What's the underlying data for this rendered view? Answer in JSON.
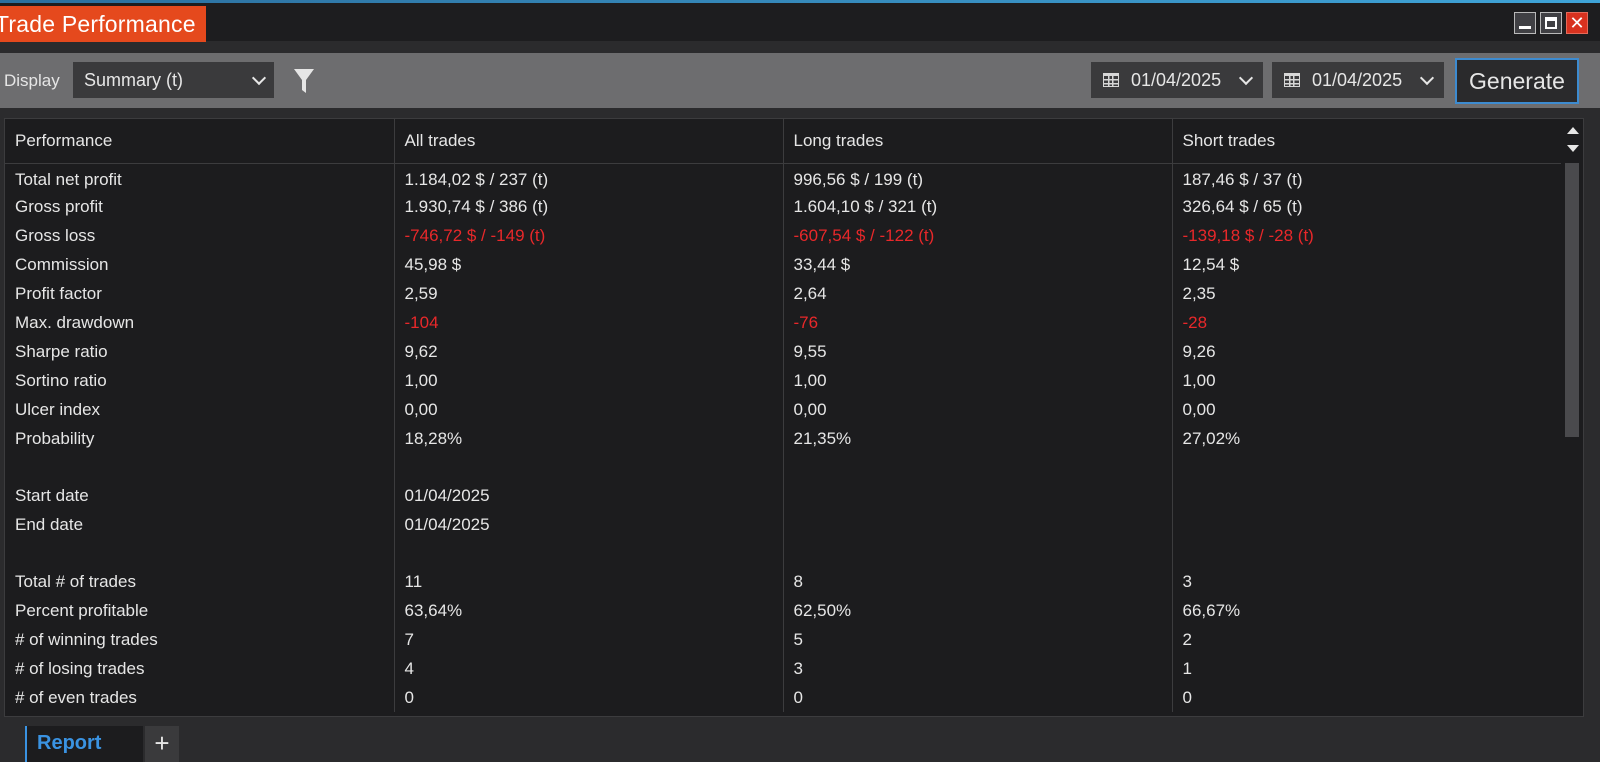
{
  "window": {
    "title": "Trade Performance"
  },
  "toolbar": {
    "display_label": "Display",
    "display_value": "Summary (t)",
    "date_from": "01/04/2025",
    "date_to": "01/04/2025",
    "generate_label": "Generate"
  },
  "table": {
    "headers": [
      "Performance",
      "All trades",
      "Long trades",
      "Short trades"
    ],
    "rows": [
      {
        "label": "Total net profit",
        "all": "1.184,02 $ / 237 (t)",
        "long": "996,56 $ / 199 (t)",
        "short": "187,46 $ / 37 (t)"
      },
      {
        "label": "Gross profit",
        "all": "1.930,74 $ / 386 (t)",
        "long": "1.604,10 $ / 321 (t)",
        "short": "326,64 $ / 65 (t)"
      },
      {
        "label": "Gross loss",
        "all": "-746,72 $ / -149 (t)",
        "long": "-607,54 $ / -122 (t)",
        "short": "-139,18 $ / -28 (t)"
      },
      {
        "label": "Commission",
        "all": "45,98 $",
        "long": "33,44 $",
        "short": "12,54 $"
      },
      {
        "label": "Profit factor",
        "all": "2,59",
        "long": "2,64",
        "short": "2,35"
      },
      {
        "label": "Max. drawdown",
        "all": "-104",
        "long": "-76",
        "short": "-28"
      },
      {
        "label": "Sharpe ratio",
        "all": "9,62",
        "long": "9,55",
        "short": "9,26"
      },
      {
        "label": "Sortino ratio",
        "all": "1,00",
        "long": "1,00",
        "short": "1,00"
      },
      {
        "label": "Ulcer index",
        "all": "0,00",
        "long": "0,00",
        "short": "0,00"
      },
      {
        "label": "Probability",
        "all": "18,28%",
        "long": "21,35%",
        "short": "27,02%"
      },
      {
        "label": "",
        "all": "",
        "long": "",
        "short": ""
      },
      {
        "label": "Start date",
        "all": "01/04/2025",
        "long": "",
        "short": ""
      },
      {
        "label": "End date",
        "all": "01/04/2025",
        "long": "",
        "short": ""
      },
      {
        "label": "",
        "all": "",
        "long": "",
        "short": ""
      },
      {
        "label": "Total # of trades",
        "all": "11",
        "long": "8",
        "short": "3"
      },
      {
        "label": "Percent profitable",
        "all": "63,64%",
        "long": "62,50%",
        "short": "66,67%"
      },
      {
        "label": "# of winning trades",
        "all": "7",
        "long": "5",
        "short": "2"
      },
      {
        "label": "# of losing trades",
        "all": "4",
        "long": "3",
        "short": "1"
      },
      {
        "label": "# of even trades",
        "all": "0",
        "long": "0",
        "short": "0"
      }
    ]
  },
  "tabs": {
    "active": "Report",
    "add": "+"
  },
  "colors": {
    "accent_orange": "#e5491d",
    "negative": "#e8282a",
    "tab_blue": "#3a93e2"
  }
}
